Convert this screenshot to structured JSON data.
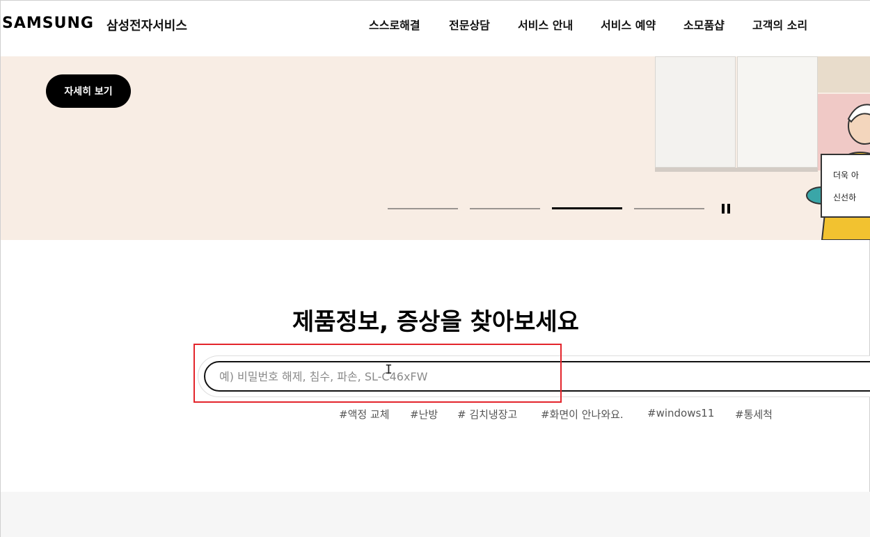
{
  "header": {
    "logo": "SAMSUNG",
    "site_name": "삼성전자서비스",
    "nav": [
      "스스로해결",
      "전문상담",
      "서비스 안내",
      "서비스 예약",
      "소모품샵",
      "고객의 소리"
    ]
  },
  "hero": {
    "detail_button": "자세히 보기",
    "sign_line1": "더욱 아",
    "sign_line2": "신선하"
  },
  "search": {
    "title": "제품정보, 증상을 찾아보세요",
    "placeholder": "예) 비밀번호 해제, 침수, 파손, SL-C46xFW",
    "tags": [
      "#액정 교체",
      "#난방",
      "# 김치냉장고",
      "#화면이 안나와요.",
      "#windows11",
      "#통세척"
    ]
  },
  "colors": {
    "hero_bg": "#f8ede4",
    "highlight": "#e3242b",
    "button_bg": "#000000"
  }
}
